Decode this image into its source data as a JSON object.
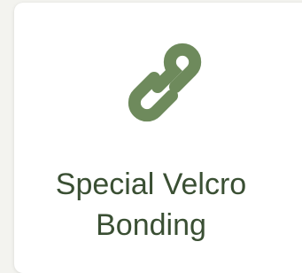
{
  "card": {
    "icon": "link-icon",
    "title_line1": "Special Velcro",
    "title_line2": "Bonding",
    "colors": {
      "icon": "#6e8a5c",
      "text": "#3a4f33",
      "card_background": "#ffffff",
      "page_background": "#f3f3ef"
    }
  }
}
